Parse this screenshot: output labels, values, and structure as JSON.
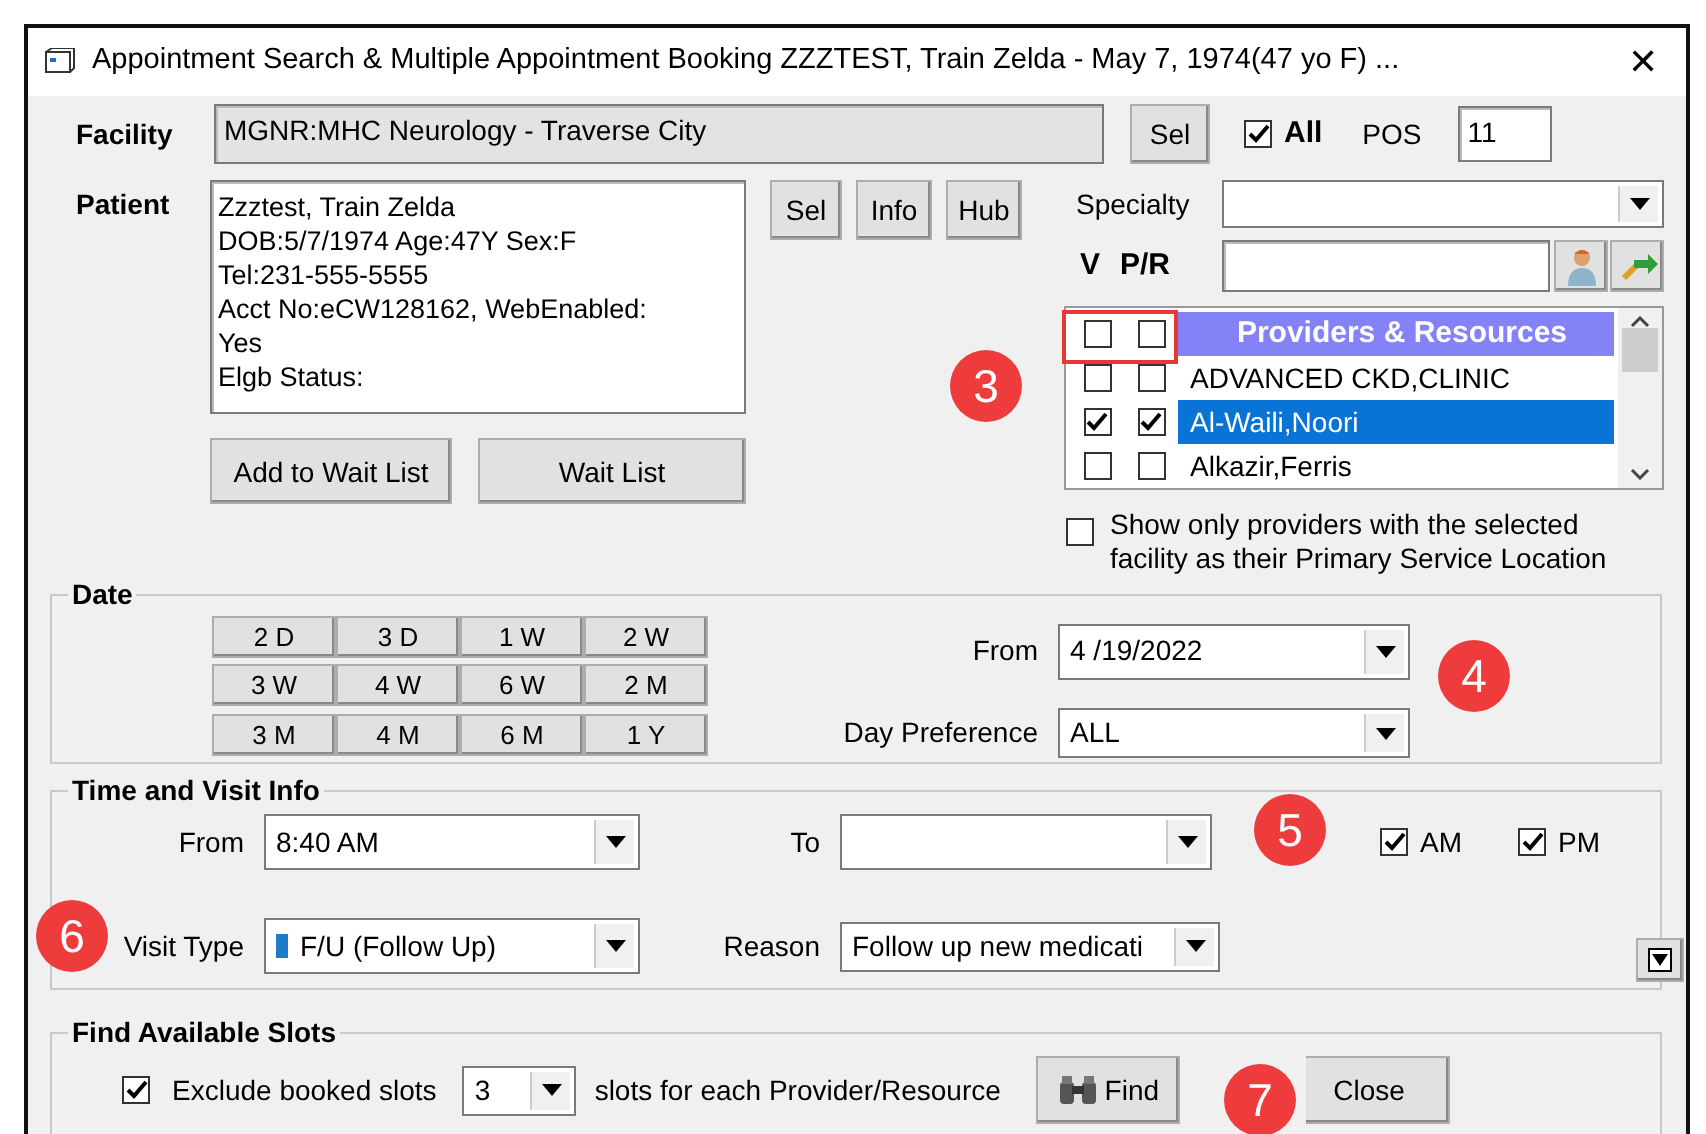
{
  "window": {
    "title": "Appointment Search & Multiple Appointment Booking ZZZTEST, Train Zelda - May 7, 1974(47 yo F) ...",
    "close": "✕"
  },
  "facility": {
    "label": "Facility",
    "value": "MGNR:MHC Neurology - Traverse City",
    "sel_button": "Sel",
    "all": {
      "label": "All",
      "checked": true
    },
    "pos_label": "POS",
    "pos_value": "11"
  },
  "patient": {
    "label": "Patient",
    "lines": [
      "Zzztest, Train Zelda",
      "DOB:5/7/1974  Age:47Y  Sex:F",
      "Tel:231-555-5555",
      "Acct No:eCW128162, WebEnabled:",
      "Yes",
      "Elgb Status:"
    ],
    "buttons": [
      "Sel",
      "Info",
      "Hub"
    ],
    "wait_buttons": [
      "Add to Wait List",
      "Wait List"
    ]
  },
  "specialty": {
    "label": "Specialty"
  },
  "pr_filter": {
    "v_label": "V",
    "pr_label": "P/R"
  },
  "providers": {
    "header": "Providers & Resources",
    "header_v_checked": false,
    "header_pr_checked": false,
    "items": [
      {
        "name": "ADVANCED CKD,CLINIC",
        "v_checked": false,
        "pr_checked": false,
        "selected": false
      },
      {
        "name": "Al-Waili,Noori",
        "v_checked": true,
        "pr_checked": true,
        "selected": true
      },
      {
        "name": "Alkazir,Ferris",
        "v_checked": false,
        "pr_checked": false,
        "selected": false
      }
    ]
  },
  "primary_only": {
    "label": "Show only providers with the selected facility as their Primary Service Location",
    "checked": false
  },
  "date": {
    "title": "Date",
    "ranges": [
      "2 D",
      "3 D",
      "1 W",
      "2 W",
      "3 W",
      "4 W",
      "6 W",
      "2 M",
      "3 M",
      "4 M",
      "6 M",
      "1 Y"
    ],
    "from_label": "From",
    "from_value": "4 /19/2022",
    "day_pref_label": "Day Preference",
    "day_pref_value": "ALL"
  },
  "time_visit": {
    "title": "Time and Visit Info",
    "from_label": "From",
    "from_value": "8:40 AM",
    "to_label": "To",
    "am": {
      "label": "AM",
      "checked": true
    },
    "pm": {
      "label": "PM",
      "checked": true
    },
    "visit_type_label": "Visit Type",
    "visit_type": {
      "value": "F/U (Follow Up)",
      "color": "#1f7cc4"
    },
    "reason_label": "Reason",
    "reason_value": "Follow up new medicati"
  },
  "find": {
    "title": "Find Available Slots",
    "exclude": {
      "label": "Exclude booked slots",
      "checked": true
    },
    "slots_value": "3",
    "slots_label": "slots for each Provider/Resource",
    "find_button": "Find",
    "close_button": "Close"
  },
  "annotations": [
    "3",
    "4",
    "5",
    "6",
    "7"
  ]
}
